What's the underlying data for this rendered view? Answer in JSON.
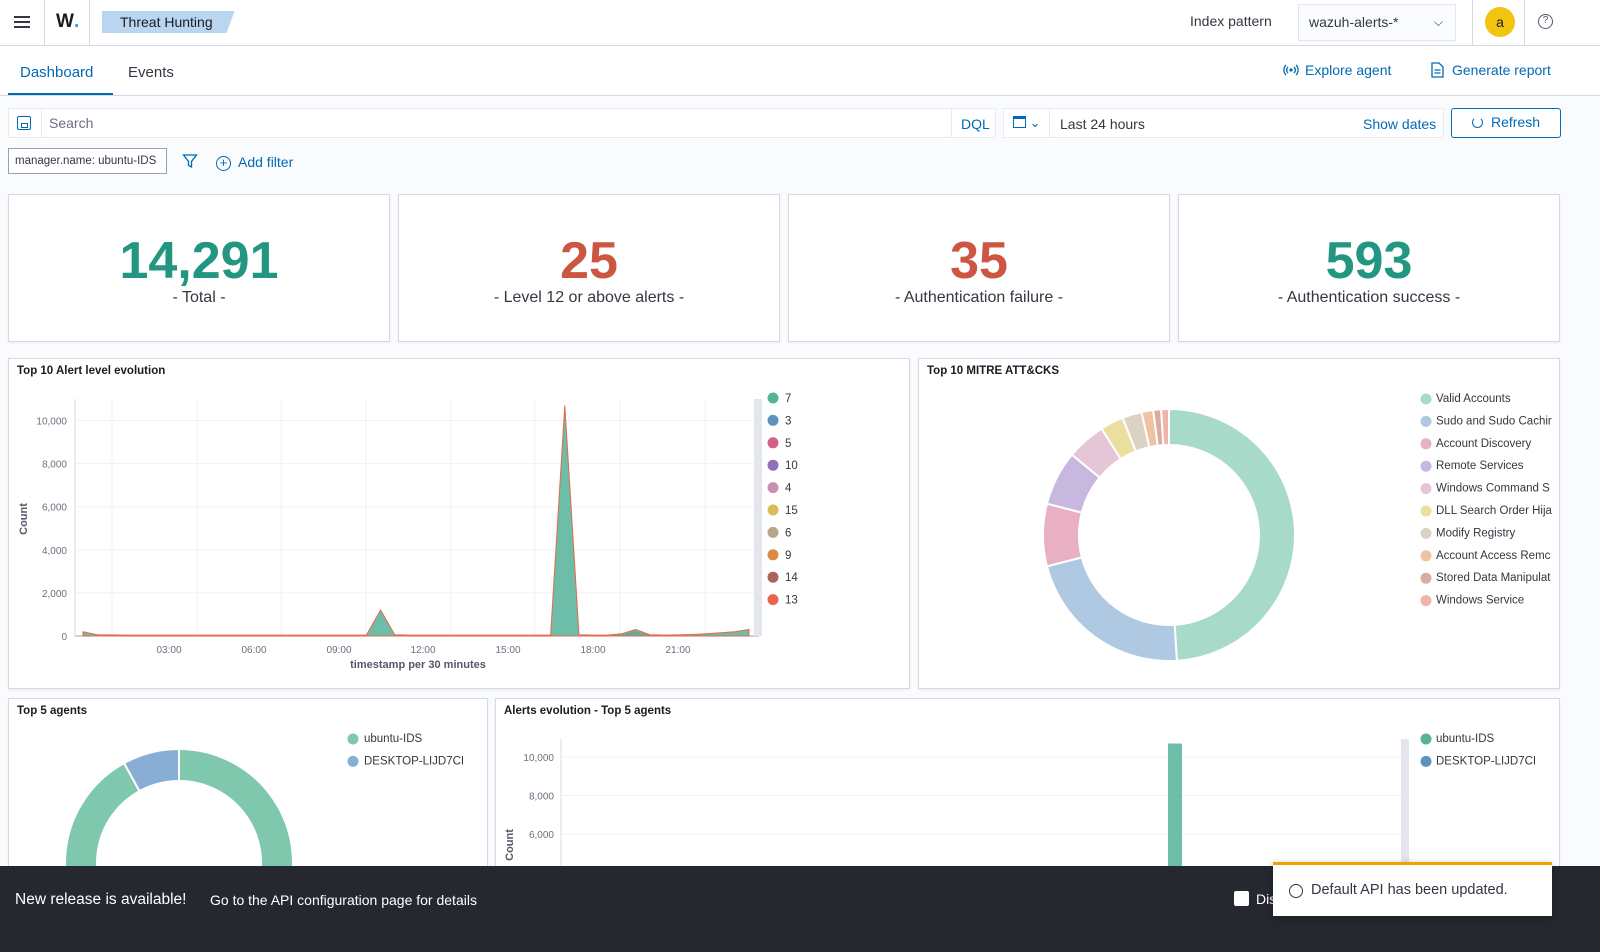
{
  "header": {
    "logo_text": "W",
    "logo_dot": ".",
    "breadcrumb": "Threat Hunting",
    "index_pattern_label": "Index pattern",
    "index_pattern_value": "wazuh-alerts-*",
    "avatar_letter": "a",
    "help_glyph": "?"
  },
  "tabs": {
    "dashboard": "Dashboard",
    "events": "Events",
    "explore_agent": "Explore agent",
    "generate_report": "Generate report"
  },
  "query": {
    "search_placeholder": "Search",
    "language": "DQL",
    "date_range": "Last 24 hours",
    "show_dates": "Show dates",
    "refresh": "Refresh",
    "filter_pill": "manager.name: ubuntu-IDS",
    "add_filter": "Add filter"
  },
  "metrics": [
    {
      "value": "14,291",
      "label": "- Total -",
      "color": "#229680"
    },
    {
      "value": "25",
      "label": "- Level 12 or above alerts -",
      "color": "#cc5641"
    },
    {
      "value": "35",
      "label": "- Authentication failure -",
      "color": "#cc5641"
    },
    {
      "value": "593",
      "label": "- Authentication success -",
      "color": "#229680"
    }
  ],
  "alert_level_panel": {
    "title": "Top 10 Alert level evolution"
  },
  "mitre_panel": {
    "title": "Top 10 MITRE ATT&CKS"
  },
  "agents_panel": {
    "title": "Top 5 agents"
  },
  "agents_evolution_panel": {
    "title": "Alerts evolution - Top 5 agents"
  },
  "chart_data": [
    {
      "type": "area",
      "title": "Top 10 Alert level evolution",
      "xlabel": "timestamp per 30 minutes",
      "ylabel": "Count",
      "ylim": [
        0,
        11000
      ],
      "yticks": [
        0,
        2000,
        4000,
        6000,
        8000,
        10000
      ],
      "ytick_labels": [
        "0",
        "2,000",
        "4,000",
        "6,000",
        "8,000",
        "10,000"
      ],
      "xtick_labels": [
        "03:00",
        "06:00",
        "09:00",
        "12:00",
        "15:00",
        "18:00",
        "21:00"
      ],
      "x": [
        "00:30",
        "01:00",
        "01:30",
        "02:00",
        "02:30",
        "03:00",
        "03:30",
        "04:00",
        "04:30",
        "05:00",
        "05:30",
        "06:00",
        "06:30",
        "07:00",
        "07:30",
        "08:00",
        "08:30",
        "09:00",
        "09:30",
        "10:00",
        "10:30",
        "11:00",
        "11:30",
        "12:00",
        "12:30",
        "13:00",
        "13:30",
        "14:00",
        "14:30",
        "15:00",
        "15:30",
        "16:00",
        "16:30",
        "17:00",
        "17:30",
        "18:00",
        "18:30",
        "19:00",
        "19:30",
        "20:00",
        "20:30",
        "21:00",
        "21:30",
        "22:00",
        "22:30",
        "23:00",
        "23:30",
        "00:00"
      ],
      "series": [
        {
          "name": "7",
          "color": "#54b399",
          "values": [
            200,
            60,
            50,
            40,
            40,
            40,
            40,
            40,
            40,
            40,
            40,
            40,
            40,
            40,
            40,
            40,
            40,
            40,
            40,
            40,
            40,
            1200,
            60,
            40,
            40,
            40,
            40,
            40,
            40,
            40,
            40,
            40,
            40,
            40,
            10700,
            60,
            40,
            40,
            100,
            300,
            60,
            40,
            50,
            70,
            100,
            150,
            200,
            300
          ]
        },
        {
          "name": "3",
          "color": "#6092c0",
          "values": [
            0,
            0,
            0,
            0,
            0,
            0,
            0,
            0,
            0,
            0,
            0,
            0,
            0,
            0,
            0,
            0,
            0,
            0,
            0,
            0,
            0,
            0,
            0,
            0,
            0,
            0,
            0,
            0,
            0,
            0,
            0,
            0,
            0,
            0,
            0,
            0,
            0,
            0,
            50,
            200,
            0,
            0,
            0,
            0,
            0,
            0,
            0,
            0
          ]
        },
        {
          "name": "5",
          "color": "#d36086",
          "values": [
            10,
            0,
            0,
            0,
            0,
            0,
            0,
            0,
            0,
            0,
            0,
            0,
            0,
            0,
            0,
            0,
            0,
            0,
            0,
            0,
            0,
            0,
            0,
            0,
            0,
            0,
            0,
            0,
            0,
            0,
            0,
            0,
            0,
            0,
            0,
            0,
            0,
            0,
            0,
            0,
            0,
            0,
            0,
            0,
            0,
            0,
            0,
            0
          ]
        },
        {
          "name": "10",
          "color": "#9170b8",
          "values": [
            0,
            0,
            0,
            0,
            0,
            0,
            0,
            0,
            0,
            0,
            0,
            0,
            0,
            0,
            0,
            0,
            0,
            0,
            0,
            0,
            0,
            0,
            0,
            0,
            0,
            0,
            0,
            0,
            0,
            0,
            0,
            0,
            0,
            0,
            0,
            0,
            0,
            0,
            0,
            0,
            0,
            0,
            0,
            0,
            0,
            0,
            0,
            0
          ]
        },
        {
          "name": "4",
          "color": "#ca8eae",
          "values": [
            0,
            0,
            0,
            0,
            0,
            0,
            0,
            0,
            0,
            0,
            0,
            0,
            0,
            0,
            0,
            0,
            0,
            0,
            0,
            0,
            0,
            0,
            0,
            0,
            0,
            0,
            0,
            0,
            0,
            0,
            0,
            0,
            0,
            0,
            0,
            0,
            0,
            0,
            0,
            0,
            0,
            0,
            0,
            0,
            0,
            0,
            0,
            0
          ]
        },
        {
          "name": "15",
          "color": "#d6bf57",
          "values": [
            0,
            0,
            0,
            0,
            0,
            0,
            0,
            0,
            0,
            0,
            0,
            0,
            0,
            0,
            0,
            0,
            0,
            0,
            0,
            0,
            0,
            0,
            0,
            0,
            0,
            0,
            0,
            0,
            0,
            0,
            0,
            0,
            0,
            0,
            0,
            0,
            0,
            0,
            0,
            0,
            0,
            0,
            0,
            0,
            0,
            0,
            0,
            0
          ]
        },
        {
          "name": "6",
          "color": "#b9a888",
          "values": [
            0,
            0,
            0,
            0,
            0,
            0,
            0,
            0,
            0,
            0,
            0,
            0,
            0,
            0,
            0,
            0,
            0,
            0,
            0,
            0,
            0,
            0,
            0,
            0,
            0,
            0,
            0,
            0,
            0,
            0,
            0,
            0,
            0,
            0,
            0,
            0,
            0,
            0,
            0,
            0,
            0,
            0,
            0,
            0,
            0,
            0,
            0,
            0
          ]
        },
        {
          "name": "9",
          "color": "#da8b45",
          "values": [
            0,
            0,
            0,
            0,
            0,
            0,
            0,
            0,
            0,
            0,
            0,
            0,
            0,
            0,
            0,
            0,
            0,
            0,
            0,
            0,
            0,
            0,
            0,
            0,
            0,
            0,
            0,
            0,
            0,
            0,
            0,
            0,
            0,
            0,
            0,
            0,
            0,
            0,
            0,
            0,
            0,
            0,
            0,
            0,
            0,
            0,
            0,
            0
          ]
        },
        {
          "name": "14",
          "color": "#aa6556",
          "values": [
            0,
            0,
            0,
            0,
            0,
            0,
            0,
            0,
            0,
            0,
            0,
            0,
            0,
            0,
            0,
            0,
            0,
            0,
            0,
            0,
            0,
            0,
            0,
            0,
            0,
            0,
            0,
            0,
            0,
            0,
            0,
            0,
            0,
            0,
            0,
            0,
            0,
            0,
            0,
            0,
            0,
            0,
            0,
            0,
            0,
            0,
            0,
            0
          ]
        },
        {
          "name": "13",
          "color": "#e7664c",
          "values": [
            0,
            0,
            0,
            0,
            0,
            0,
            0,
            0,
            0,
            0,
            0,
            0,
            0,
            0,
            0,
            0,
            0,
            0,
            0,
            0,
            0,
            0,
            0,
            0,
            0,
            0,
            0,
            0,
            0,
            0,
            0,
            0,
            0,
            0,
            0,
            0,
            0,
            0,
            0,
            0,
            0,
            0,
            0,
            0,
            0,
            0,
            0,
            0
          ]
        }
      ]
    },
    {
      "type": "pie",
      "title": "Top 10 MITRE ATT&CKS",
      "donut": true,
      "categories": [
        "Valid Accounts",
        "Sudo and Sudo Cachir",
        "Account Discovery",
        "Remote Services",
        "Windows Command S",
        "DLL Search Order Hija",
        "Modify Registry",
        "Account Access Remc",
        "Stored Data Manipulat",
        "Windows Service"
      ],
      "values": [
        49,
        22,
        8,
        7,
        5,
        3,
        2.5,
        1.5,
        1,
        1
      ],
      "colors": [
        "#a8dac9",
        "#b0c9e2",
        "#e9afc2",
        "#c8b7de",
        "#e4c6d7",
        "#eadf9e",
        "#dcd2c3",
        "#efc3a1",
        "#d9aba1",
        "#f2b2a7"
      ]
    },
    {
      "type": "pie",
      "title": "Top 5 agents",
      "donut": true,
      "categories": [
        "ubuntu-IDS",
        "DESKTOP-LIJD7CI"
      ],
      "values": [
        92,
        8
      ],
      "colors": [
        "#7fc8ae",
        "#89aed6"
      ]
    },
    {
      "type": "bar",
      "title": "Alerts evolution - Top 5 agents",
      "ylabel": "Count",
      "yticks": [
        6000,
        8000,
        10000
      ],
      "ytick_labels": [
        "6,000",
        "8,000",
        "10,000"
      ],
      "series": [
        {
          "name": "ubuntu-IDS",
          "color": "#54b399",
          "values": [
            10700
          ]
        },
        {
          "name": "DESKTOP-LIJD7CI",
          "color": "#6092c0",
          "values": [
            0
          ]
        }
      ]
    }
  ],
  "release_bar": {
    "title": "New release is available!",
    "detail": "Go to the API configuration page for details",
    "dismiss": "Dis"
  },
  "toast": {
    "text": "Default API has been updated.",
    "accent": "#f1a100"
  }
}
